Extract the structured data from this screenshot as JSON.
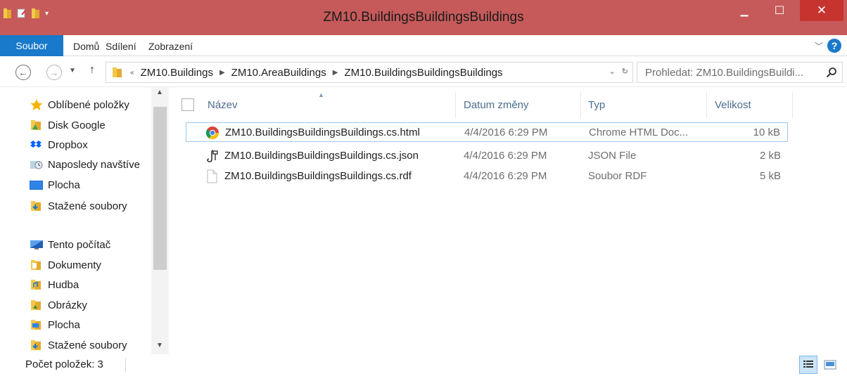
{
  "window": {
    "title": "ZM10.BuildingsBuildingsBuildings",
    "minimize_glyph": "▁",
    "maximize_glyph": "☐",
    "close_glyph": "✕",
    "titlebar_color": "#c65a5a"
  },
  "ribbon": {
    "file_tab": "Soubor",
    "tabs": [
      "Domů",
      "Sdílení",
      "Zobrazení"
    ],
    "accent_color": "#1979ca"
  },
  "address": {
    "breadcrumbs": [
      "ZM10.Buildings",
      "ZM10.AreaBuildings",
      "ZM10.BuildingsBuildingsBuildings"
    ],
    "search_placeholder": "Prohledat: ZM10.BuildingsBuildi..."
  },
  "sidebar": {
    "favorites": [
      {
        "label": "Oblíbené položky",
        "icon": "star-icon"
      },
      {
        "label": "Disk Google",
        "icon": "google-drive-folder-icon"
      },
      {
        "label": "Dropbox",
        "icon": "dropbox-icon"
      },
      {
        "label": "Naposledy navštíve",
        "icon": "recent-places-icon"
      },
      {
        "label": "Plocha",
        "icon": "desktop-icon"
      },
      {
        "label": "Stažené soubory",
        "icon": "downloads-folder-icon"
      }
    ],
    "computer": [
      {
        "label": "Tento počítač",
        "icon": "this-pc-icon"
      },
      {
        "label": "Dokumenty",
        "icon": "documents-folder-icon"
      },
      {
        "label": "Hudba",
        "icon": "music-folder-icon"
      },
      {
        "label": "Obrázky",
        "icon": "pictures-folder-icon"
      },
      {
        "label": "Plocha",
        "icon": "desktop-folder-icon"
      },
      {
        "label": "Stažené soubory",
        "icon": "downloads-folder-icon"
      }
    ]
  },
  "filelist": {
    "columns": {
      "name": "Název",
      "date": "Datum změny",
      "type": "Typ",
      "size": "Velikost"
    },
    "rows": [
      {
        "name": "ZM10.BuildingsBuildingsBuildings.cs.html",
        "date": "4/4/2016 6:29 PM",
        "type": "Chrome HTML Doc...",
        "size": "10 kB",
        "icon": "chrome-icon"
      },
      {
        "name": "ZM10.BuildingsBuildingsBuildings.cs.json",
        "date": "4/4/2016 6:29 PM",
        "type": "JSON File",
        "size": "2 kB",
        "icon": "json-file-icon"
      },
      {
        "name": "ZM10.BuildingsBuildingsBuildings.cs.rdf",
        "date": "4/4/2016 6:29 PM",
        "type": "Soubor RDF",
        "size": "5 kB",
        "icon": "generic-file-icon"
      }
    ]
  },
  "status": {
    "item_count": "Počet položek: 3"
  }
}
